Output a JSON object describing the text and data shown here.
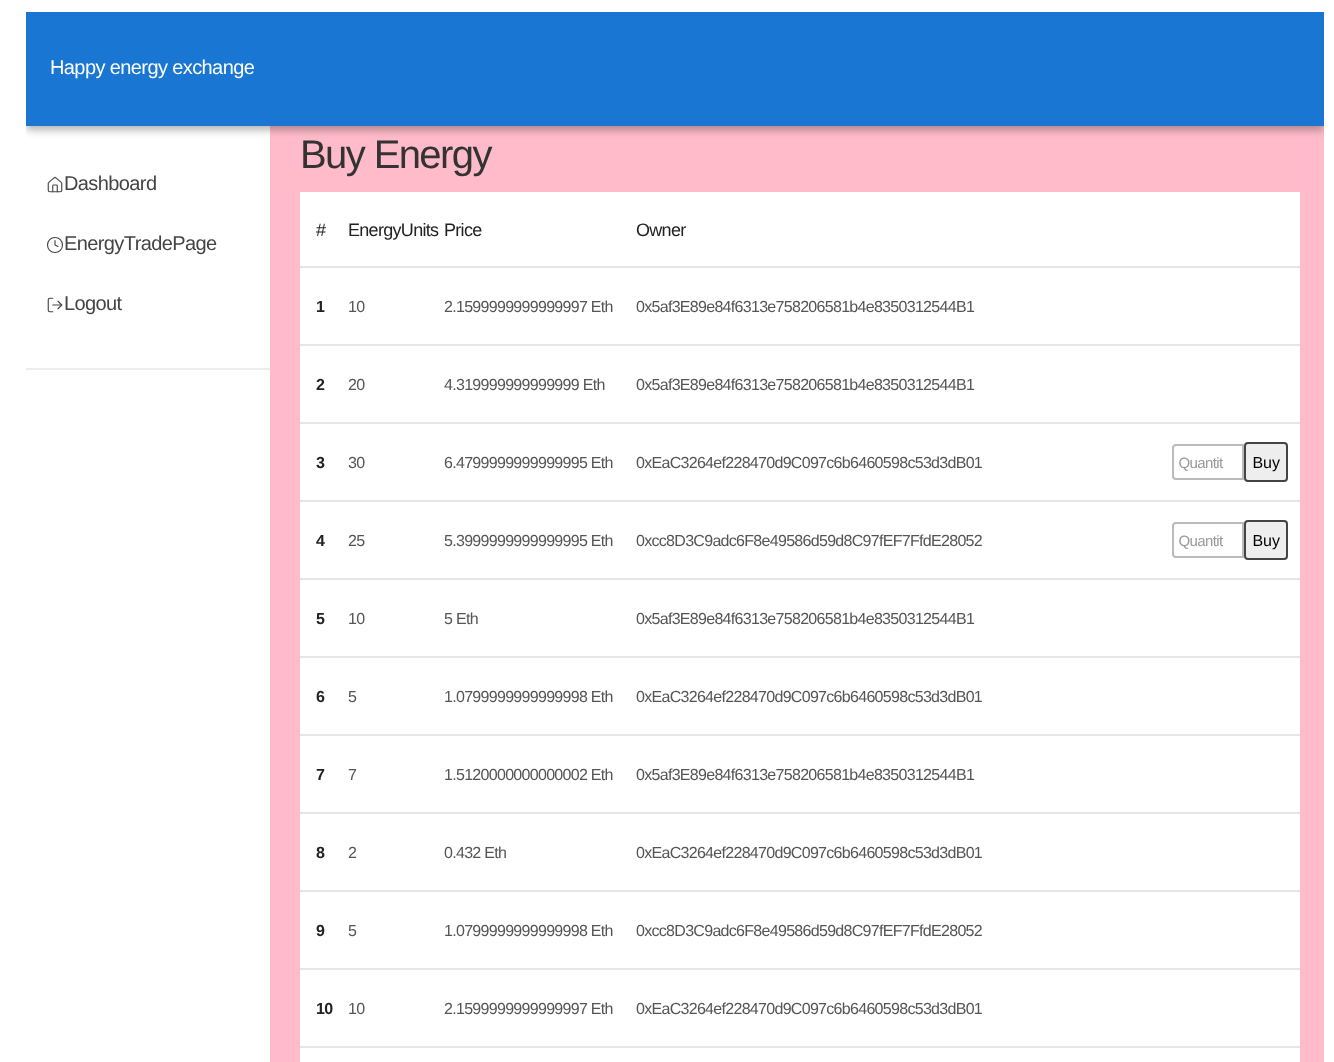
{
  "app_bar": {
    "title": "Happy energy exchange"
  },
  "sidebar": {
    "items": [
      {
        "label": "Dashboard",
        "kind": "home"
      },
      {
        "label": "EnergyTradePage",
        "kind": "clock"
      },
      {
        "label": "Logout",
        "kind": "logout"
      }
    ]
  },
  "page": {
    "heading": "Buy Energy"
  },
  "table": {
    "columns": [
      "#",
      "EnergyUnits",
      "Price",
      "Owner"
    ],
    "rows": [
      {
        "cells": [
          "1",
          "10",
          "2.1599999999999997 Eth",
          "0x5af3E89e84f6313e758206581b4e8350312544B1"
        ]
      },
      {
        "cells": [
          "2",
          "20",
          "4.319999999999999 Eth",
          "0x5af3E89e84f6313e758206581b4e8350312544B1"
        ]
      },
      {
        "cells": [
          "3",
          "30",
          "6.4799999999999995 Eth",
          "0xEaC3264ef228470d9C097c6b6460598c53d3dB01"
        ],
        "buy": {
          "placeholder": "Quantit",
          "button": "Buy"
        }
      },
      {
        "cells": [
          "4",
          "25",
          "5.3999999999999995 Eth",
          "0xcc8D3C9adc6F8e49586d59d8C97fEF7FfdE28052"
        ],
        "buy": {
          "placeholder": "Quantit",
          "button": "Buy"
        }
      },
      {
        "cells": [
          "5",
          "10",
          "5 Eth",
          "0x5af3E89e84f6313e758206581b4e8350312544B1"
        ]
      },
      {
        "cells": [
          "6",
          "5",
          "1.0799999999999998 Eth",
          "0xEaC3264ef228470d9C097c6b6460598c53d3dB01"
        ]
      },
      {
        "cells": [
          "7",
          "7",
          "1.5120000000000002 Eth",
          "0x5af3E89e84f6313e758206581b4e8350312544B1"
        ]
      },
      {
        "cells": [
          "8",
          "2",
          "0.432 Eth",
          "0xEaC3264ef228470d9C097c6b6460598c53d3dB01"
        ]
      },
      {
        "cells": [
          "9",
          "5",
          "1.0799999999999998 Eth",
          "0xcc8D3C9adc6F8e49586d59d8C97fEF7FfdE28052"
        ]
      },
      {
        "cells": [
          "10",
          "10",
          "2.1599999999999997 Eth",
          "0xEaC3264ef228470d9C097c6b6460598c53d3dB01"
        ]
      }
    ]
  }
}
